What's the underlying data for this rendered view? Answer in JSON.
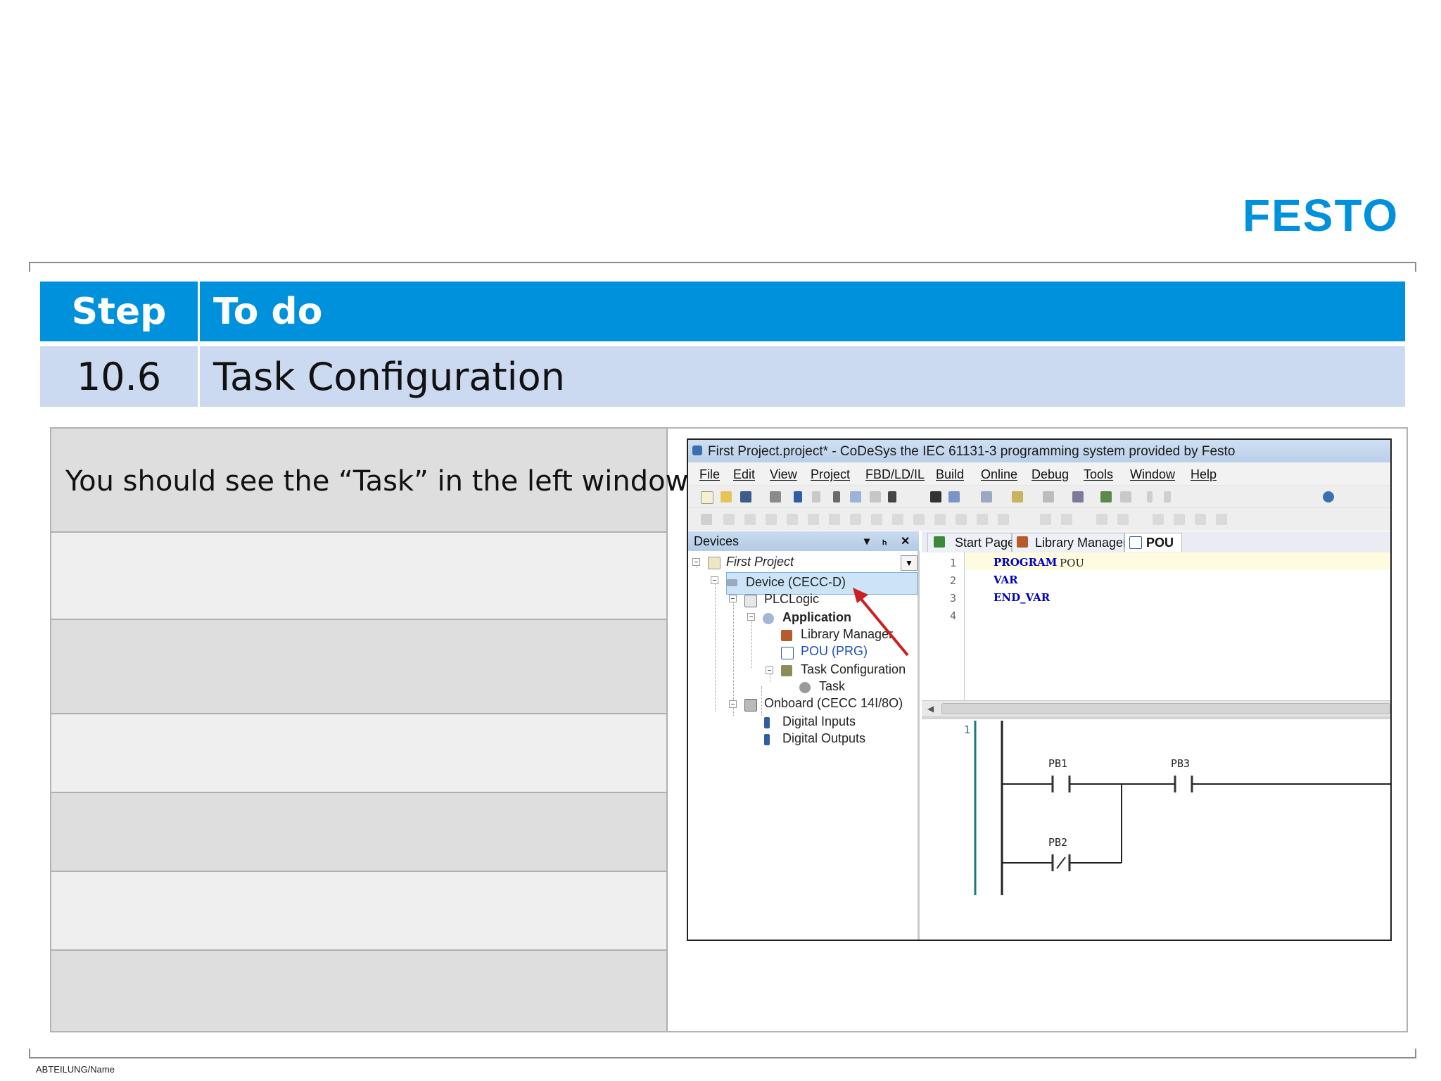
{
  "brand": {
    "logo_text": "FESTO",
    "color": "#0091DC"
  },
  "table": {
    "header": {
      "step": "Step",
      "todo": "To do"
    },
    "row": {
      "step": "10.6",
      "todo": "Task Configuration"
    },
    "header_color": "#0091DC",
    "row_color": "#CBDAF0"
  },
  "instruction": "You should see the “Task” in the left window.",
  "screenshot": {
    "title": "First Project.project* - CoDeSys the IEC 61131-3 programming system provided by Festo",
    "menu": [
      "File",
      "Edit",
      "View",
      "Project",
      "FBD/LD/IL",
      "Build",
      "Online",
      "Debug",
      "Tools",
      "Window",
      "Help"
    ],
    "devices_panel": {
      "title": "Devices",
      "controls": [
        "▾",
        "ₕ",
        "✕"
      ],
      "tree": [
        {
          "label": "First Project"
        },
        {
          "label": "Device (CECC-D)"
        },
        {
          "label": "PLCLogic"
        },
        {
          "label": "Application"
        },
        {
          "label": "Library Manager"
        },
        {
          "label": "POU (PRG)"
        },
        {
          "label": "Task Configuration"
        },
        {
          "label": "Task"
        },
        {
          "label": "Onboard (CECC 14I/8O)"
        },
        {
          "label": "Digital Inputs"
        },
        {
          "label": "Digital Outputs"
        }
      ]
    },
    "tabs": [
      "Start Page",
      "Library Manager",
      "POU"
    ],
    "code_lines": [
      {
        "n": "1",
        "kw": "PROGRAM",
        "rest": "POU"
      },
      {
        "n": "2",
        "kw": "VAR",
        "rest": ""
      },
      {
        "n": "3",
        "kw": "END_VAR",
        "rest": ""
      },
      {
        "n": "4",
        "kw": "",
        "rest": ""
      }
    ],
    "ladder": {
      "network": "1",
      "contacts": [
        "PB1",
        "PB3",
        "PB2"
      ]
    }
  },
  "footer": "ABTEILUNG/Name"
}
